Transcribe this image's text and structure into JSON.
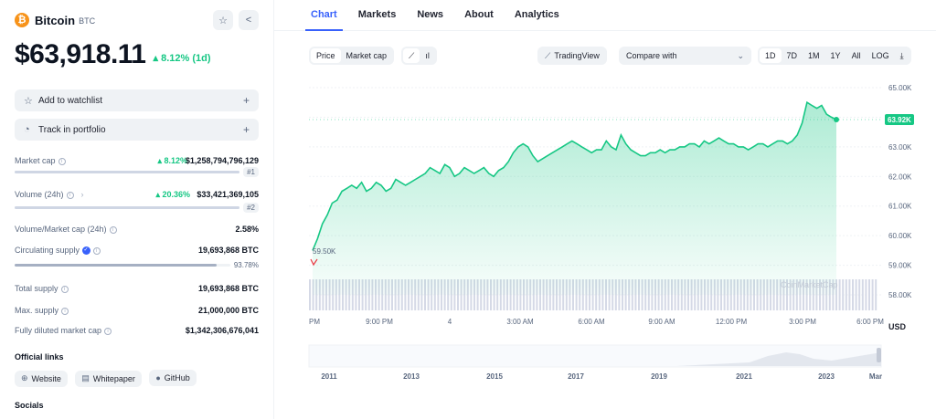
{
  "coin": {
    "name": "Bitcoin",
    "symbol": "BTC",
    "price": "$63,918.11",
    "change": "8.12% (1d)"
  },
  "actions": {
    "watchlist": "Add to watchlist",
    "portfolio": "Track in portfolio"
  },
  "stats": {
    "market_cap": {
      "label": "Market cap",
      "pct": "8.12%",
      "value": "$1,258,794,796,129",
      "rank": "#1"
    },
    "volume": {
      "label": "Volume (24h)",
      "pct": "20.36%",
      "value": "$33,421,369,105",
      "rank": "#2"
    },
    "vol_mcap": {
      "label": "Volume/Market cap (24h)",
      "value": "2.58%"
    },
    "circ_supply": {
      "label": "Circulating supply",
      "value": "19,693,868 BTC",
      "pct": "93.78%",
      "fraction": 0.9378
    },
    "total_supply": {
      "label": "Total supply",
      "value": "19,693,868 BTC"
    },
    "max_supply": {
      "label": "Max. supply",
      "value": "21,000,000 BTC"
    },
    "fdmc": {
      "label": "Fully diluted market cap",
      "value": "$1,342,306,676,041"
    }
  },
  "links": {
    "title": "Official links",
    "website": "Website",
    "whitepaper": "Whitepaper",
    "github": "GitHub"
  },
  "socials": {
    "title": "Socials"
  },
  "tabs": [
    "Chart",
    "Markets",
    "News",
    "About",
    "Analytics"
  ],
  "toolbar": {
    "price": "Price",
    "market_cap": "Market cap",
    "tradingview": "TradingView",
    "compare": "Compare with",
    "ranges": [
      "1D",
      "7D",
      "1M",
      "1Y",
      "All"
    ],
    "log": "LOG"
  },
  "chart_data": {
    "type": "line",
    "y_ticks": [
      "65.00K",
      "64.00K",
      "63.00K",
      "62.00K",
      "61.00K",
      "60.00K",
      "59.00K",
      "58.00K"
    ],
    "ylim": [
      58000,
      65000
    ],
    "x_ticks": [
      "PM",
      "9:00 PM",
      "4",
      "3:00 AM",
      "6:00 AM",
      "9:00 AM",
      "12:00 PM",
      "3:00 PM",
      "6:00 PM"
    ],
    "currency": "USD",
    "current_label": "63.92K",
    "low_label": "59.50K",
    "watermark": "CoinMarketCap",
    "values": [
      59500,
      59900,
      60400,
      60700,
      61100,
      61200,
      61500,
      61600,
      61700,
      61600,
      61800,
      61500,
      61600,
      61800,
      61700,
      61500,
      61600,
      61900,
      61800,
      61700,
      61800,
      61900,
      62000,
      62100,
      62300,
      62200,
      62100,
      62400,
      62300,
      62000,
      62100,
      62300,
      62200,
      62100,
      62200,
      62300,
      62100,
      62000,
      62200,
      62300,
      62500,
      62800,
      63000,
      63100,
      63000,
      62700,
      62500,
      62600,
      62700,
      62800,
      62900,
      63000,
      63100,
      63200,
      63100,
      63000,
      62900,
      62800,
      62900,
      62900,
      63200,
      63000,
      62900,
      63400,
      63100,
      62900,
      62800,
      62700,
      62700,
      62800,
      62800,
      62900,
      62800,
      62900,
      62900,
      63000,
      63000,
      63100,
      63100,
      63000,
      63200,
      63100,
      63200,
      63300,
      63200,
      63100,
      63100,
      63000,
      63000,
      62900,
      63000,
      63100,
      63100,
      63000,
      63100,
      63200,
      63200,
      63100,
      63200,
      63400,
      63800,
      64500,
      64400,
      64300,
      64400,
      64100,
      64000,
      63920
    ],
    "timeline_ticks": [
      "2011",
      "2013",
      "2015",
      "2017",
      "2019",
      "2021",
      "2023",
      "Mar"
    ]
  }
}
